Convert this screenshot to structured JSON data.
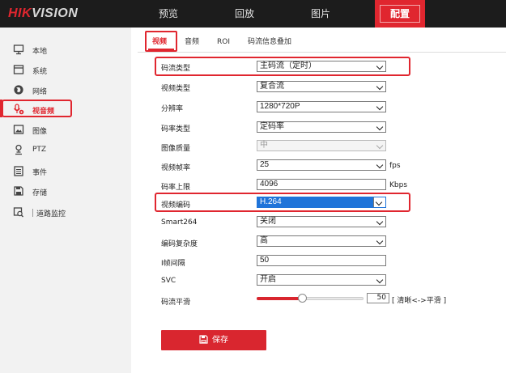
{
  "brand": {
    "part1": "HIK",
    "part2": "VISION",
    "accent": "#e0262f"
  },
  "nav": [
    {
      "label": "预览",
      "active": false
    },
    {
      "label": "回放",
      "active": false
    },
    {
      "label": "图片",
      "active": false
    },
    {
      "label": "配置",
      "active": true
    }
  ],
  "sidebar": {
    "items": [
      {
        "label": "本地",
        "icon": "monitor-icon"
      },
      {
        "label": "系统",
        "icon": "window-icon"
      },
      {
        "label": "网络",
        "icon": "globe-icon"
      },
      {
        "label": "视音频",
        "icon": "audio-video-icon",
        "active": true
      },
      {
        "label": "图像",
        "icon": "image-icon"
      },
      {
        "label": "PTZ",
        "icon": "ptz-icon"
      },
      {
        "label": "事件",
        "icon": "calendar-icon"
      },
      {
        "label": "存储",
        "icon": "storage-icon"
      },
      {
        "label": "道路监控",
        "icon": "road-monitor-icon"
      }
    ]
  },
  "tabs": [
    {
      "label": "视频",
      "active": true
    },
    {
      "label": "音频"
    },
    {
      "label": "ROI"
    },
    {
      "label": "码流信息叠加"
    }
  ],
  "form": {
    "stream_type": {
      "label": "码流类型",
      "value": "主码流（定时）"
    },
    "video_type": {
      "label": "视频类型",
      "value": "复合流"
    },
    "resolution": {
      "label": "分辨率",
      "value": "1280*720P"
    },
    "bitrate_type": {
      "label": "码率类型",
      "value": "定码率"
    },
    "image_quality": {
      "label": "图像质量",
      "value": "中"
    },
    "frame_rate": {
      "label": "视频帧率",
      "value": "25",
      "unit": "fps"
    },
    "max_bitrate": {
      "label": "码率上限",
      "value": "4096",
      "unit": "Kbps"
    },
    "video_encoding": {
      "label": "视频编码",
      "value": "H.264"
    },
    "smart264": {
      "label": "Smart264",
      "value": "关闭"
    },
    "complexity": {
      "label": "编码复杂度",
      "value": "高"
    },
    "i_frame_interval": {
      "label": "I帧间隔",
      "value": "50"
    },
    "svc": {
      "label": "SVC",
      "value": "开启"
    },
    "smoothing": {
      "label": "码流平滑",
      "value": "50",
      "level": 0.5,
      "hint": "[ 清晰<->平滑 ]"
    }
  },
  "save_label": "保存"
}
